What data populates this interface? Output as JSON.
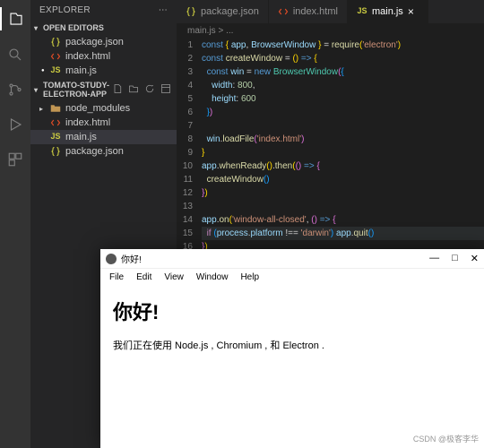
{
  "sidebar": {
    "title": "EXPLORER",
    "openEditors": "OPEN EDITORS",
    "project": "TOMATO-STUDY-ELECTRON-APP",
    "open": [
      {
        "label": "package.json",
        "kind": "json",
        "dirty": false
      },
      {
        "label": "index.html",
        "kind": "html",
        "dirty": false
      },
      {
        "label": "main.js",
        "kind": "js",
        "dirty": true
      }
    ],
    "tree": [
      {
        "label": "node_modules",
        "kind": "folder"
      },
      {
        "label": "index.html",
        "kind": "html"
      },
      {
        "label": "main.js",
        "kind": "js",
        "active": true
      },
      {
        "label": "package.json",
        "kind": "json"
      }
    ]
  },
  "tabs": [
    {
      "label": "package.json",
      "kind": "json",
      "active": false
    },
    {
      "label": "index.html",
      "kind": "html",
      "active": false
    },
    {
      "label": "main.js",
      "kind": "js",
      "active": true
    }
  ],
  "breadcrumb": "main.js > ...",
  "code": [
    {
      "n": 1,
      "t": [
        [
          "kw",
          "const"
        ],
        [
          "pun",
          " "
        ],
        [
          "brace1",
          "{"
        ],
        [
          "pun",
          " "
        ],
        [
          "var",
          "app"
        ],
        [
          "pun",
          ", "
        ],
        [
          "var",
          "BrowserWindow"
        ],
        [
          "pun",
          " "
        ],
        [
          "brace1",
          "}"
        ],
        [
          "pun",
          " = "
        ],
        [
          "fn",
          "require"
        ],
        [
          "brace1",
          "("
        ],
        [
          "str",
          "'electron'"
        ],
        [
          "brace1",
          ")"
        ]
      ]
    },
    {
      "n": 2,
      "t": [
        [
          "kw",
          "const"
        ],
        [
          "pun",
          " "
        ],
        [
          "fn",
          "createWindow"
        ],
        [
          "pun",
          " = "
        ],
        [
          "brace1",
          "("
        ],
        [
          "brace1",
          ")"
        ],
        [
          "pun",
          " "
        ],
        [
          "kw",
          "=>"
        ],
        [
          "pun",
          " "
        ],
        [
          "brace1",
          "{"
        ]
      ]
    },
    {
      "n": 3,
      "t": [
        [
          "pun",
          "  "
        ],
        [
          "kw",
          "const"
        ],
        [
          "pun",
          " "
        ],
        [
          "var",
          "win"
        ],
        [
          "pun",
          " = "
        ],
        [
          "kw",
          "new"
        ],
        [
          "pun",
          " "
        ],
        [
          "cls",
          "BrowserWindow"
        ],
        [
          "brace2",
          "("
        ],
        [
          "brace3",
          "{"
        ]
      ]
    },
    {
      "n": 4,
      "t": [
        [
          "pun",
          "    "
        ],
        [
          "prop",
          "width"
        ],
        [
          "pun",
          ": "
        ],
        [
          "num",
          "800"
        ],
        [
          "pun",
          ","
        ]
      ]
    },
    {
      "n": 5,
      "t": [
        [
          "pun",
          "    "
        ],
        [
          "prop",
          "height"
        ],
        [
          "pun",
          ": "
        ],
        [
          "num",
          "600"
        ]
      ]
    },
    {
      "n": 6,
      "t": [
        [
          "pun",
          "  "
        ],
        [
          "brace3",
          "}"
        ],
        [
          "brace2",
          ")"
        ]
      ]
    },
    {
      "n": 7,
      "t": []
    },
    {
      "n": 8,
      "t": [
        [
          "pun",
          "  "
        ],
        [
          "var",
          "win"
        ],
        [
          "pun",
          "."
        ],
        [
          "fn",
          "loadFile"
        ],
        [
          "brace2",
          "("
        ],
        [
          "str",
          "'index.html'"
        ],
        [
          "brace2",
          ")"
        ]
      ]
    },
    {
      "n": 9,
      "t": [
        [
          "brace1",
          "}"
        ]
      ]
    },
    {
      "n": 10,
      "t": [
        [
          "var",
          "app"
        ],
        [
          "pun",
          "."
        ],
        [
          "fn",
          "whenReady"
        ],
        [
          "brace1",
          "("
        ],
        [
          "brace1",
          ")"
        ],
        [
          "pun",
          "."
        ],
        [
          "fn",
          "then"
        ],
        [
          "brace1",
          "("
        ],
        [
          "brace2",
          "("
        ],
        [
          "brace2",
          ")"
        ],
        [
          "pun",
          " "
        ],
        [
          "kw",
          "=>"
        ],
        [
          "pun",
          " "
        ],
        [
          "brace2",
          "{"
        ]
      ]
    },
    {
      "n": 11,
      "t": [
        [
          "pun",
          "  "
        ],
        [
          "fn",
          "createWindow"
        ],
        [
          "brace3",
          "("
        ],
        [
          "brace3",
          ")"
        ]
      ]
    },
    {
      "n": 12,
      "t": [
        [
          "brace2",
          "}"
        ],
        [
          "brace1",
          ")"
        ]
      ]
    },
    {
      "n": 13,
      "t": []
    },
    {
      "n": 14,
      "t": [
        [
          "var",
          "app"
        ],
        [
          "pun",
          "."
        ],
        [
          "fn",
          "on"
        ],
        [
          "brace1",
          "("
        ],
        [
          "str",
          "'window-all-closed'"
        ],
        [
          "pun",
          ", "
        ],
        [
          "brace2",
          "("
        ],
        [
          "brace2",
          ")"
        ],
        [
          "pun",
          " "
        ],
        [
          "kw",
          "=>"
        ],
        [
          "pun",
          " "
        ],
        [
          "brace2",
          "{"
        ]
      ]
    },
    {
      "n": 15,
      "hl": true,
      "t": [
        [
          "pun",
          "  "
        ],
        [
          "kw2",
          "if"
        ],
        [
          "pun",
          " "
        ],
        [
          "brace3",
          "("
        ],
        [
          "var",
          "process"
        ],
        [
          "pun",
          "."
        ],
        [
          "prop",
          "platform"
        ],
        [
          "pun",
          " !== "
        ],
        [
          "str",
          "'darwin'"
        ],
        [
          "brace3",
          ")"
        ],
        [
          "pun",
          " "
        ],
        [
          "var",
          "app"
        ],
        [
          "pun",
          "."
        ],
        [
          "fn",
          "quit"
        ],
        [
          "brace3",
          "("
        ],
        [
          "brace3",
          ")"
        ]
      ]
    },
    {
      "n": 16,
      "t": [
        [
          "brace2",
          "}"
        ],
        [
          "brace1",
          ")"
        ]
      ]
    }
  ],
  "appwin": {
    "title": "你好!",
    "menus": [
      "File",
      "Edit",
      "View",
      "Window",
      "Help"
    ],
    "heading": "你好!",
    "body": "我们正在使用 Node.js , Chromium , 和 Electron ."
  },
  "watermark": "CSDN @极客李华"
}
